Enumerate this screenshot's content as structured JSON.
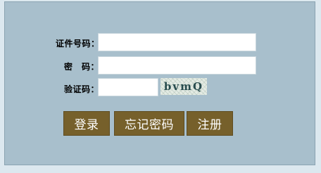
{
  "form": {
    "id_label": "证件号码：",
    "password_label": "密　码：",
    "captcha_label": "验证码：",
    "id_value": "",
    "password_value": "",
    "captcha_value": "",
    "captcha_text": "bvmQ"
  },
  "buttons": {
    "login": "登录",
    "forgot_password": "忘记密码",
    "register": "注册"
  },
  "colors": {
    "page_background": "#dce8ef",
    "panel_background": "#a8bfcc",
    "button_background": "#76602b"
  }
}
